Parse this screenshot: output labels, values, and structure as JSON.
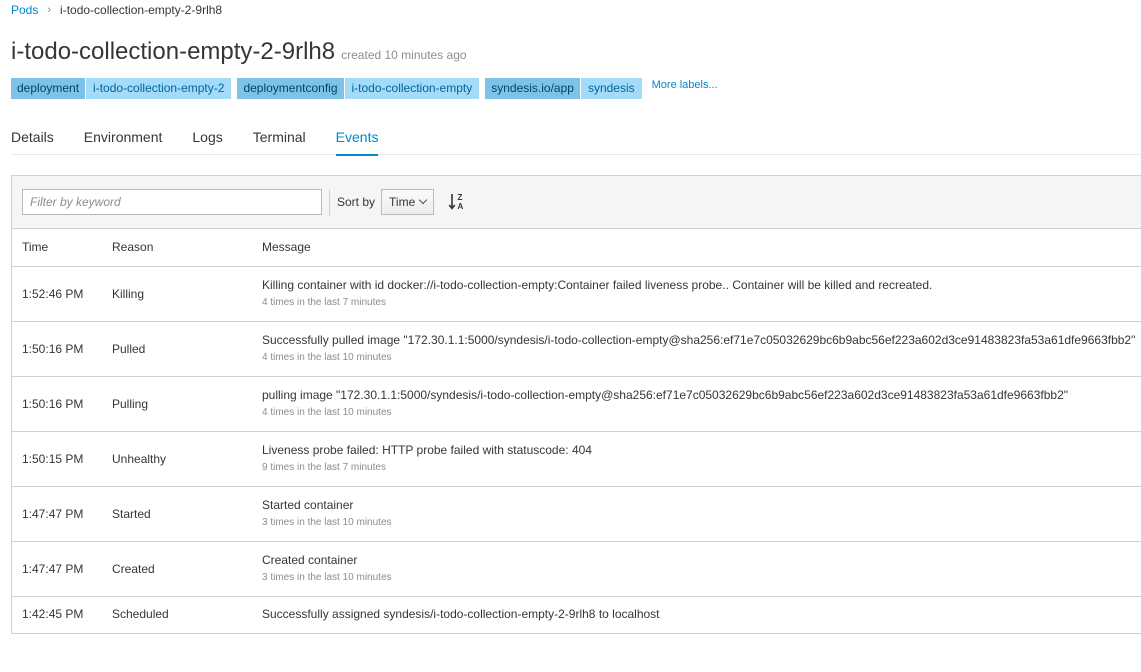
{
  "breadcrumb": {
    "parent": "Pods",
    "separator": "›",
    "current": "i-todo-collection-empty-2-9rlh8"
  },
  "header": {
    "title": "i-todo-collection-empty-2-9rlh8",
    "created": "created 10 minutes ago"
  },
  "labels": [
    {
      "key": "deployment",
      "value": "i-todo-collection-empty-2"
    },
    {
      "key": "deploymentconfig",
      "value": "i-todo-collection-empty"
    },
    {
      "key": "syndesis.io/app",
      "value": "syndesis"
    }
  ],
  "more_labels": "More labels...",
  "tabs": [
    {
      "label": "Details",
      "active": false
    },
    {
      "label": "Environment",
      "active": false
    },
    {
      "label": "Logs",
      "active": false
    },
    {
      "label": "Terminal",
      "active": false
    },
    {
      "label": "Events",
      "active": true
    }
  ],
  "toolbar": {
    "filter_placeholder": "Filter by keyword",
    "sort_by_label": "Sort by",
    "sort_value": "Time",
    "sort_direction_icon": "sort-alpha-desc-icon"
  },
  "table": {
    "headers": {
      "time": "Time",
      "reason": "Reason",
      "message": "Message"
    },
    "rows": [
      {
        "time": "1:52:46 PM",
        "reason": "Killing",
        "warning": false,
        "message": "Killing container with id docker://i-todo-collection-empty:Container failed liveness probe.. Container will be killed and recreated.",
        "count": "4 times in the last 7 minutes"
      },
      {
        "time": "1:50:16 PM",
        "reason": "Pulled",
        "warning": false,
        "message": "Successfully pulled image \"172.30.1.1:5000/syndesis/i-todo-collection-empty@sha256:ef71e7c05032629bc6b9abc56ef223a602d3ce91483823fa53a61dfe9663fbb2\"",
        "count": "4 times in the last 10 minutes"
      },
      {
        "time": "1:50:16 PM",
        "reason": "Pulling",
        "warning": false,
        "message": "pulling image \"172.30.1.1:5000/syndesis/i-todo-collection-empty@sha256:ef71e7c05032629bc6b9abc56ef223a602d3ce91483823fa53a61dfe9663fbb2\"",
        "count": "4 times in the last 10 minutes"
      },
      {
        "time": "1:50:15 PM",
        "reason": "Unhealthy",
        "warning": true,
        "message": "Liveness probe failed: HTTP probe failed with statuscode: 404",
        "count": "9 times in the last 7 minutes"
      },
      {
        "time": "1:47:47 PM",
        "reason": "Started",
        "warning": false,
        "message": "Started container",
        "count": "3 times in the last 10 minutes"
      },
      {
        "time": "1:47:47 PM",
        "reason": "Created",
        "warning": false,
        "message": "Created container",
        "count": "3 times in the last 10 minutes"
      },
      {
        "time": "1:42:45 PM",
        "reason": "Scheduled",
        "warning": false,
        "message": "Successfully assigned syndesis/i-todo-collection-empty-2-9rlh8 to localhost",
        "count": ""
      }
    ]
  },
  "colors": {
    "link": "#0088ce",
    "label_key_bg": "#7dc3e8",
    "label_value_bg": "#a3dbf9",
    "warning": "#ec7a08",
    "muted_text": "#8b8d8f"
  }
}
